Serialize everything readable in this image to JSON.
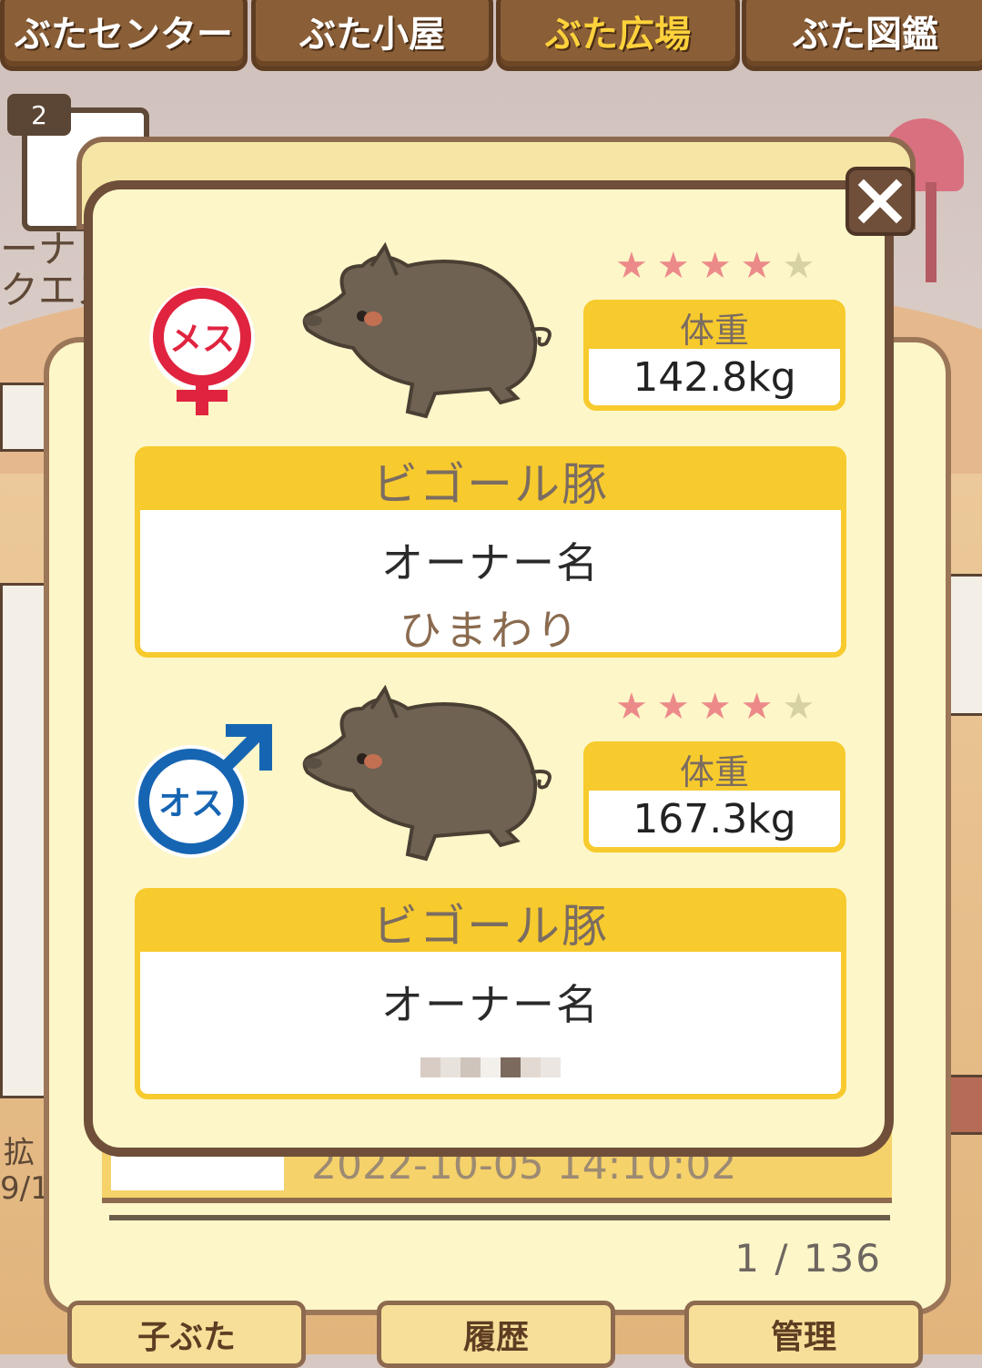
{
  "nav": {
    "tabs": [
      {
        "label": "ぶたセンター",
        "active": false
      },
      {
        "label": "ぶた小屋",
        "active": false
      },
      {
        "label": "ぶた広場",
        "active": true
      },
      {
        "label": "ぶた図鑑",
        "active": false
      }
    ]
  },
  "background": {
    "badge_count": "2",
    "side_text_1": "ーナ",
    "side_text_2": "クエス",
    "side_text_3": "拡",
    "side_text_4": "9/1",
    "list_date": "2022-10-05 14:10:02",
    "pager": "1 / 136",
    "bottom_buttons": [
      "子ぶた",
      "履歴",
      "管理"
    ]
  },
  "dialog": {
    "close_icon": "close-icon",
    "pigs": [
      {
        "sex": "female",
        "sex_label": "メス",
        "rating": 4,
        "rating_max": 5,
        "weight_label": "体重",
        "weight": "142.8kg",
        "breed": "ビゴール豚",
        "owner_label": "オーナー名",
        "owner_name": "ひまわり"
      },
      {
        "sex": "male",
        "sex_label": "オス",
        "rating": 4,
        "rating_max": 5,
        "weight_label": "体重",
        "weight": "167.3kg",
        "breed": "ビゴール豚",
        "owner_label": "オーナー名",
        "owner_name": ""
      }
    ]
  },
  "colors": {
    "accent_yellow": "#f7ca2d",
    "frame_brown": "#6f4f3a",
    "female_red": "#e0243f",
    "male_blue": "#1665b3",
    "star_pink": "#ec8a8a"
  }
}
